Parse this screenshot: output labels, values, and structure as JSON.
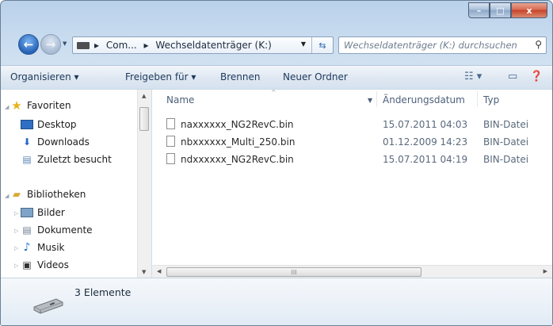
{
  "window": {
    "caption_buttons": {
      "minimize": "–",
      "maximize": "□",
      "close": "x"
    }
  },
  "address": {
    "crumbs": [
      "Com...",
      "▸",
      "Wechseldatenträger (K:)"
    ],
    "separator_first": "▸",
    "refresh_icon": "refresh-icon"
  },
  "search": {
    "placeholder": "Wechseldatenträger (K:) durchsuchen"
  },
  "toolbar": {
    "organize": "Organisieren ▾",
    "share": "Freigeben für ▾",
    "burn": "Brennen",
    "new_folder": "Neuer Ordner"
  },
  "nav": {
    "favorites": "Favoriten",
    "fav_items": [
      "Desktop",
      "Downloads",
      "Zuletzt besucht"
    ],
    "libraries": "Bibliotheken",
    "lib_items": [
      "Bilder",
      "Dokumente",
      "Musik",
      "Videos"
    ]
  },
  "columns": {
    "name": "Name",
    "date": "Änderungsdatum",
    "type": "Typ"
  },
  "files": [
    {
      "name": "naxxxxxx_NG2RevC.bin",
      "date": "15.07.2011 04:03",
      "type": "BIN-Datei"
    },
    {
      "name": "nbxxxxxx_Multi_250.bin",
      "date": "01.12.2009 14:23",
      "type": "BIN-Datei"
    },
    {
      "name": "ndxxxxxx_NG2RevC.bin",
      "date": "15.07.2011 04:19",
      "type": "BIN-Datei"
    }
  ],
  "status": {
    "count": "3 Elemente"
  },
  "colors": {
    "accent": "#2763b6",
    "toolbar_text": "#1e395b",
    "close": "#c7432a"
  }
}
